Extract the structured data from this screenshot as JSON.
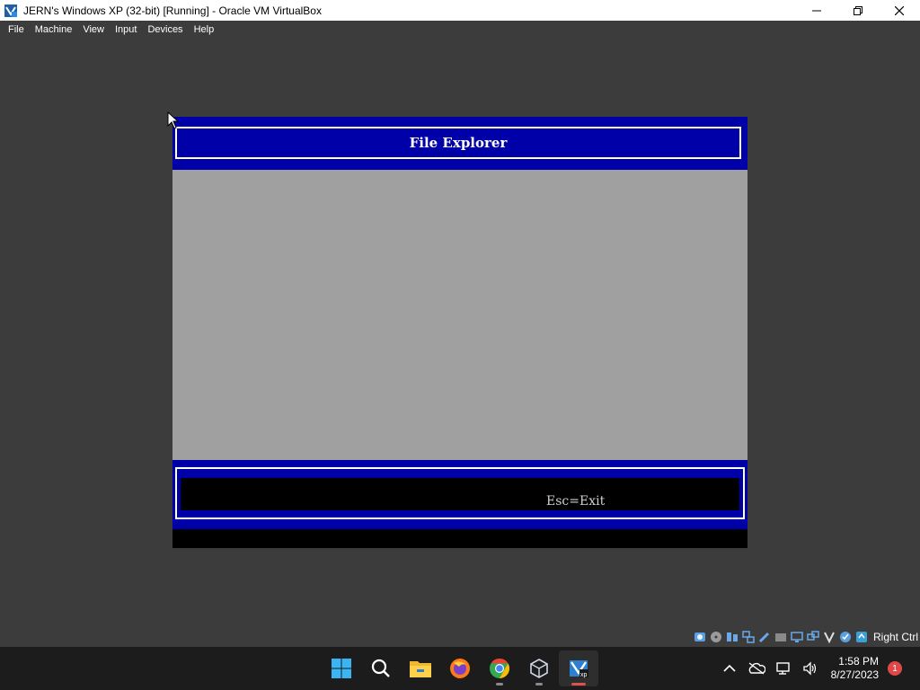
{
  "window": {
    "title": "JERN's Windows XP (32-bit) [Running] - Oracle VM VirtualBox",
    "controls": [
      "minimize-icon",
      "maximize-icon",
      "close-icon"
    ]
  },
  "menubar": {
    "items": [
      {
        "label": "File"
      },
      {
        "label": "Machine"
      },
      {
        "label": "View"
      },
      {
        "label": "Input"
      },
      {
        "label": "Devices"
      },
      {
        "label": "Help"
      }
    ]
  },
  "vm": {
    "header_title": "File Explorer",
    "footer_hint": "Esc=Exit",
    "colors": {
      "band": "#0000a8",
      "content": "#a0a0a0",
      "text": "#ffffff"
    }
  },
  "status_bar": {
    "icons": [
      "hard-disk-icon",
      "optical-disk-icon",
      "audio-icon",
      "network-icon",
      "usb-icon",
      "shared-folder-icon",
      "display-icon",
      "recording-icon",
      "cpu-icon",
      "mouse-integration-icon",
      "keyboard-icon"
    ],
    "host_key": "Right Ctrl"
  },
  "taskbar": {
    "apps": [
      "windows-start-icon",
      "search-icon",
      "file-explorer-icon",
      "firefox-icon",
      "chrome-icon",
      "virtualbox-icon",
      "vm-window-icon"
    ],
    "tray_icons": [
      "chevron-up-icon",
      "onedrive-icon",
      "network-icon",
      "volume-icon"
    ],
    "time": "1:58 PM",
    "date": "8/27/2023",
    "notification_count": "1"
  }
}
